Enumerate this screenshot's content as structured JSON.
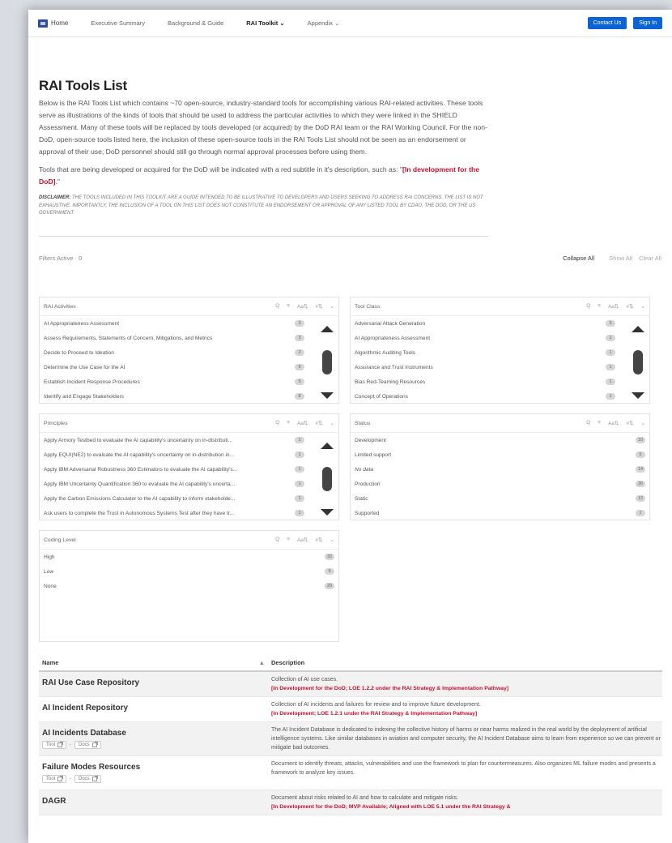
{
  "nav": {
    "home": "Home",
    "links": [
      "Executive Summary",
      "Background & Guide",
      "RAI Toolkit ⌄",
      "Appendix ⌄"
    ],
    "contact": "Contact Us",
    "signin": "Sign In"
  },
  "page": {
    "title": "RAI Tools List",
    "intro": "Below is the RAI Tools List which contains ~70 open-source, industry-standard tools for accomplishing various RAI-related activities. These tools serve as illustrations of the kinds of tools that should be used to address the particular activities to which they were linked in the SHIELD Assessment. Many of these tools will be replaced by tools developed (or acquired) by the DoD RAI team or the RAI Working Council. For the non-DoD, open-source tools listed here, the inclusion of these open-source tools in the RAI Tools List should not be seen as an endorsement or approval of their use; DoD personnel should still go through normal approval processes before using them.",
    "intro2_prefix": "Tools that are being developed or acquired for the DoD will be indicated with a red subtitle in it's description, such as: \"",
    "intro2_red": "[In development for the DoD]",
    "intro2_suffix": ".\"",
    "disclaimer_label": "DISCLAIMER:",
    "disclaimer_text": " The tools included in this toolkit are a guide intended to be illustrative to developers and users seeking to address RAI concerns. The list is not exhaustive. Importantly, the inclusion of a tool on this list does not constitute an endorsement or approval of any listed tool by CDAO, the DOD, or the US Government."
  },
  "filters": {
    "active": "Filters Active · 0",
    "collapse_all": "Collapse All",
    "show_all": "Show All",
    "clear_all": "Clear All",
    "tools": [
      "Q",
      "≡",
      "Aa⇅",
      "#⇅",
      "⌄"
    ]
  },
  "panels": {
    "rai_activities": {
      "title": "RAI Activities",
      "rows": [
        {
          "label": "AI Appropriateness Assessment",
          "count": "3"
        },
        {
          "label": "Assess Requirements, Statements of Concern, Mitigations, and Metrics",
          "count": "3"
        },
        {
          "label": "Decide to Proceed to Ideation",
          "count": "2"
        },
        {
          "label": "Determine the Use Case for the AI",
          "count": "6"
        },
        {
          "label": "Establish Incident Response Procedures",
          "count": "5"
        },
        {
          "label": "Identify and Engage Stakeholders",
          "count": "8"
        }
      ]
    },
    "tool_class": {
      "title": "Tool Class",
      "rows": [
        {
          "label": "Adversarial Attack Generation",
          "count": "3"
        },
        {
          "label": "AI Appropriateness Assessment",
          "count": "1"
        },
        {
          "label": "Algorithmic Auditing Tools",
          "count": "1"
        },
        {
          "label": "Assurance and Trust Instruments",
          "count": "1"
        },
        {
          "label": "Bias Red-Teaming Resources",
          "count": "1"
        },
        {
          "label": "Concept of Operations",
          "count": "1"
        }
      ]
    },
    "principles": {
      "title": "Principles",
      "rows": [
        {
          "label": "Apply Armory Testbed to evaluate the AI capability's uncertainty on in-distributi...",
          "count": "1"
        },
        {
          "label": "Apply EQUI(NE2) to evaluate the AI capability's uncertainty on in-distribution in...",
          "count": "1"
        },
        {
          "label": "Apply IBM Adversarial Robustness 360 Estimators to evaluate the AI capability's...",
          "count": "1"
        },
        {
          "label": "Apply IBM Uncertainty Quantification 360 to evaluate the AI capability's uncerta...",
          "count": "1"
        },
        {
          "label": "Apply the Carbon Emissions Calculator to the AI capability to inform stakeholde...",
          "count": "1"
        },
        {
          "label": "Ask users to complete the Trust in Autonomous Systems Test after they have tr...",
          "count": "1"
        }
      ]
    },
    "status": {
      "title": "Status",
      "rows": [
        {
          "label": "Development",
          "count": "10",
          "italic": false
        },
        {
          "label": "Limited support",
          "count": "5",
          "italic": false
        },
        {
          "label": "No data",
          "count": "14",
          "italic": true
        },
        {
          "label": "Production",
          "count": "30",
          "italic": false
        },
        {
          "label": "Static",
          "count": "12",
          "italic": false
        },
        {
          "label": "Supported",
          "count": "1",
          "italic": false
        }
      ]
    },
    "coding_level": {
      "title": "Coding Level",
      "rows": [
        {
          "label": "High",
          "count": "32"
        },
        {
          "label": "Low",
          "count": "9"
        },
        {
          "label": "None",
          "count": "29"
        }
      ]
    }
  },
  "table": {
    "col_name": "Name",
    "col_desc": "Description",
    "sort_icon": "▲",
    "rows": [
      {
        "name": "RAI Use Case Repository",
        "desc": "Collection of AI use cases.",
        "sub": "[In Development for the DoD; LOE 1.2.2 under the RAI Strategy & Implementation Pathway]",
        "chips": false
      },
      {
        "name": "AI Incident Repository",
        "desc": "Collection of AI incidents and failures for review and to improve future development.",
        "sub": "[In Development; LOE 1.2.1 under the RAI Strategy & Implementation Pathway]",
        "chips": false
      },
      {
        "name": "AI Incidents Database",
        "desc": "The AI Incident Database is dedicated to indexing the collective history of harms or near harms realized in the real world by the deployment of artificial intelligence systems. Like similar databases in aviation and computer security, the AI Incident Database aims to learn from experience so we can prevent or mitigate bad outcomes.",
        "sub": "",
        "chips": true
      },
      {
        "name": "Failure Modes Resources",
        "desc": "Document to identify threats, attacks, vulnerabilities and use the framework to plan for countermeasures. Also organizes ML failure modes and presents a framework to analyze key issues.",
        "sub": "",
        "chips": true
      },
      {
        "name": "DAGR",
        "desc": "Document about risks related to AI and how to calculate and mitigate risks.",
        "sub": "[In Development for the DoD; MVP Available; Aligned with LOE 5.1 under the RAI Strategy &",
        "chips": false
      }
    ],
    "chip_tool": "Tool",
    "chip_sep": "-",
    "chip_docs": "Docs"
  }
}
